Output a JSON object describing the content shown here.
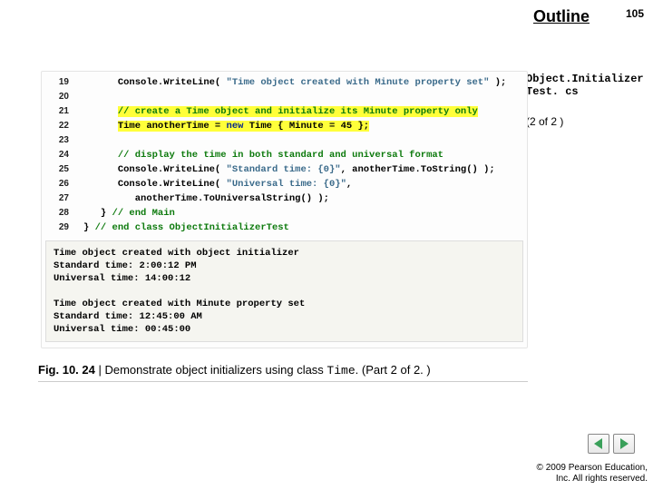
{
  "header": {
    "outline": "Outline",
    "page": "105"
  },
  "sidebar": {
    "filename_l1": "Object.Initializer",
    "filename_l2": "Test. cs",
    "pagepart": "(2 of 2 )"
  },
  "code": {
    "lines": [
      {
        "n": "19",
        "pre": "      ",
        "segs": [
          {
            "t": "plain",
            "v": "Console.WriteLine( "
          },
          {
            "t": "str",
            "v": "\"Time object created with Minute property set\""
          },
          {
            "t": "plain",
            "v": " );"
          }
        ]
      },
      {
        "n": "20",
        "pre": "",
        "segs": []
      },
      {
        "n": "21",
        "pre": "      ",
        "hl": true,
        "segs": [
          {
            "t": "cm",
            "v": "// create a Time object and initialize its Minute property only"
          }
        ]
      },
      {
        "n": "22",
        "pre": "      ",
        "hl": true,
        "segs": [
          {
            "t": "plain",
            "v": "Time anotherTime = "
          },
          {
            "t": "kw",
            "v": "new"
          },
          {
            "t": "plain",
            "v": " Time { Minute = 45 };"
          }
        ]
      },
      {
        "n": "23",
        "pre": "",
        "segs": []
      },
      {
        "n": "24",
        "pre": "      ",
        "segs": [
          {
            "t": "cm",
            "v": "// display the time in both standard and universal format"
          }
        ]
      },
      {
        "n": "25",
        "pre": "      ",
        "segs": [
          {
            "t": "plain",
            "v": "Console.WriteLine( "
          },
          {
            "t": "str",
            "v": "\"Standard time: {0}\""
          },
          {
            "t": "plain",
            "v": ", anotherTime.ToString() );"
          }
        ]
      },
      {
        "n": "26",
        "pre": "      ",
        "segs": [
          {
            "t": "plain",
            "v": "Console.WriteLine( "
          },
          {
            "t": "str",
            "v": "\"Universal time: {0}\""
          },
          {
            "t": "plain",
            "v": ","
          }
        ]
      },
      {
        "n": "27",
        "pre": "         ",
        "segs": [
          {
            "t": "plain",
            "v": "anotherTime.ToUniversalString() );"
          }
        ]
      },
      {
        "n": "28",
        "pre": "   ",
        "segs": [
          {
            "t": "plain",
            "v": "} "
          },
          {
            "t": "cm",
            "v": "// end Main"
          }
        ]
      },
      {
        "n": "29",
        "pre": "",
        "segs": [
          {
            "t": "plain",
            "v": "} "
          },
          {
            "t": "cm",
            "v": "// end class ObjectInitializerTest"
          }
        ]
      }
    ],
    "output": "Time object created with object initializer\nStandard time: 2:00:12 PM\nUniversal time: 14:00:12\n\nTime object created with Minute property set\nStandard time: 12:45:00 AM\nUniversal time: 00:45:00"
  },
  "caption": {
    "figno": "Fig. 10. 24",
    "sep": " | ",
    "text1": "Demonstrate object initializers using class ",
    "mono": "Time",
    "text2": ". (Part 2 of 2. )"
  },
  "footer": {
    "l1": "© 2009 Pearson Education,",
    "l2": "Inc.  All rights reserved."
  },
  "nav": {
    "prev": "prev",
    "next": "next"
  }
}
